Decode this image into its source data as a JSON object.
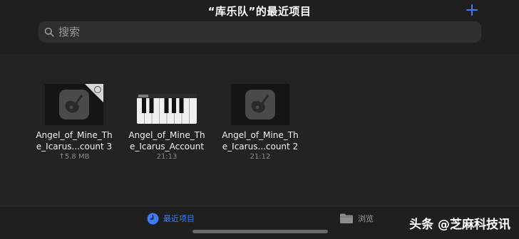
{
  "header": {
    "title": "“库乐队”的最近项目",
    "add_icon": "plus-icon",
    "accent_color": "#3d7cf4"
  },
  "search": {
    "placeholder": "搜索",
    "icon": "search-icon"
  },
  "files": [
    {
      "name_line1": "Angel_of_Mine_Th",
      "name_line2": "e_Icarus...count 3",
      "meta": "↑5.8 MB",
      "thumbnail": "garageband-icon",
      "cloud_badge": true
    },
    {
      "name_line1": "Angel_of_Mine_Th",
      "name_line2": "e_Icarus_Account",
      "meta": "21:13",
      "thumbnail": "piano-keyboard-icon"
    },
    {
      "name_line1": "Angel_of_Mine_Th",
      "name_line2": "e_Icarus...count 2",
      "meta": "21:12",
      "thumbnail": "garageband-icon"
    }
  ],
  "tabs": [
    {
      "label": "最近项目",
      "icon": "clock-icon",
      "active": true
    },
    {
      "label": "浏览",
      "icon": "folder-icon",
      "active": false
    }
  ],
  "watermark": "头条 @芝麻科技讯"
}
